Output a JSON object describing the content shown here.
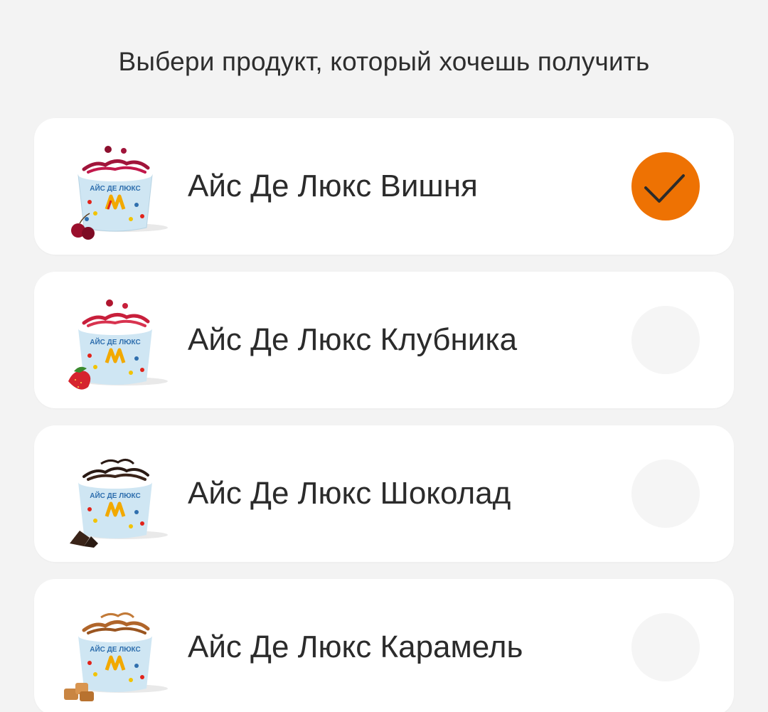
{
  "prompt": "Выбери продукт, который хочешь получить",
  "colors": {
    "accent": "#ee7203",
    "background": "#f3f3f3",
    "card": "#ffffff"
  },
  "products": [
    {
      "name": "Айс Де Люкс Вишня",
      "selected": true,
      "topping": "cherry",
      "icon": "ice-cream-cherry-icon",
      "cup_label": "АЙС ДЕ ЛЮКС"
    },
    {
      "name": "Айс Де Люкс Клубника",
      "selected": false,
      "topping": "strawberry",
      "icon": "ice-cream-strawberry-icon",
      "cup_label": "АЙС ДЕ ЛЮКС"
    },
    {
      "name": "Айс Де Люкс Шоколад",
      "selected": false,
      "topping": "chocolate",
      "icon": "ice-cream-chocolate-icon",
      "cup_label": "АЙС ДЕ ЛЮКС"
    },
    {
      "name": "Айс Де Люкс Карамель",
      "selected": false,
      "topping": "caramel",
      "icon": "ice-cream-caramel-icon",
      "cup_label": "АЙС ДЕ ЛЮКС"
    }
  ]
}
